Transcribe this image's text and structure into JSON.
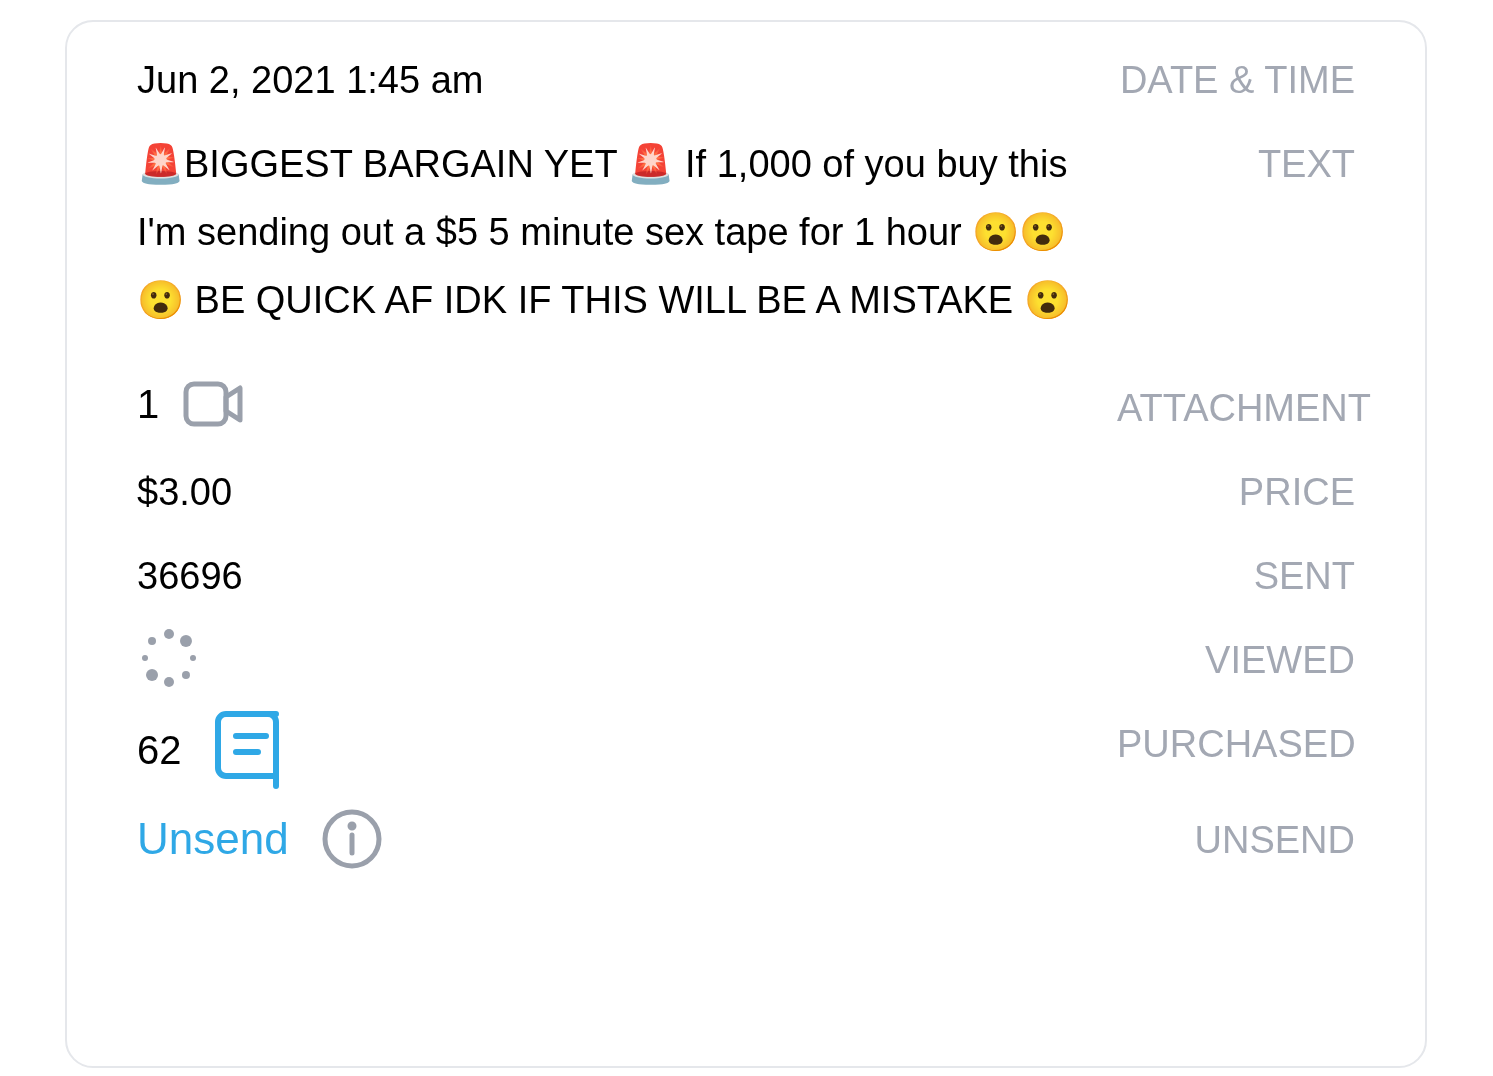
{
  "rows": [
    {
      "kind": "text",
      "label": "DATE & TIME",
      "value": "Jun 2, 2021 1:45 am"
    },
    {
      "kind": "text",
      "label": "TEXT",
      "value": "🚨BIGGEST BARGAIN YET 🚨 If 1,000 of you buy this I'm sending out a $5 5 minute sex tape for 1 hour 😮😮😮 BE QUICK AF IDK IF THIS WILL BE A MISTAKE 😮"
    },
    {
      "kind": "attachment",
      "label": "ATTACHMENT",
      "value": "1"
    },
    {
      "kind": "text",
      "label": "PRICE",
      "value": "$3.00"
    },
    {
      "kind": "text",
      "label": "SENT",
      "value": "36696"
    },
    {
      "kind": "loading",
      "label": "VIEWED"
    },
    {
      "kind": "chat",
      "label": "PURCHASED",
      "value": "62"
    },
    {
      "kind": "link",
      "label": "UNSEND",
      "value": "Unsend"
    }
  ]
}
